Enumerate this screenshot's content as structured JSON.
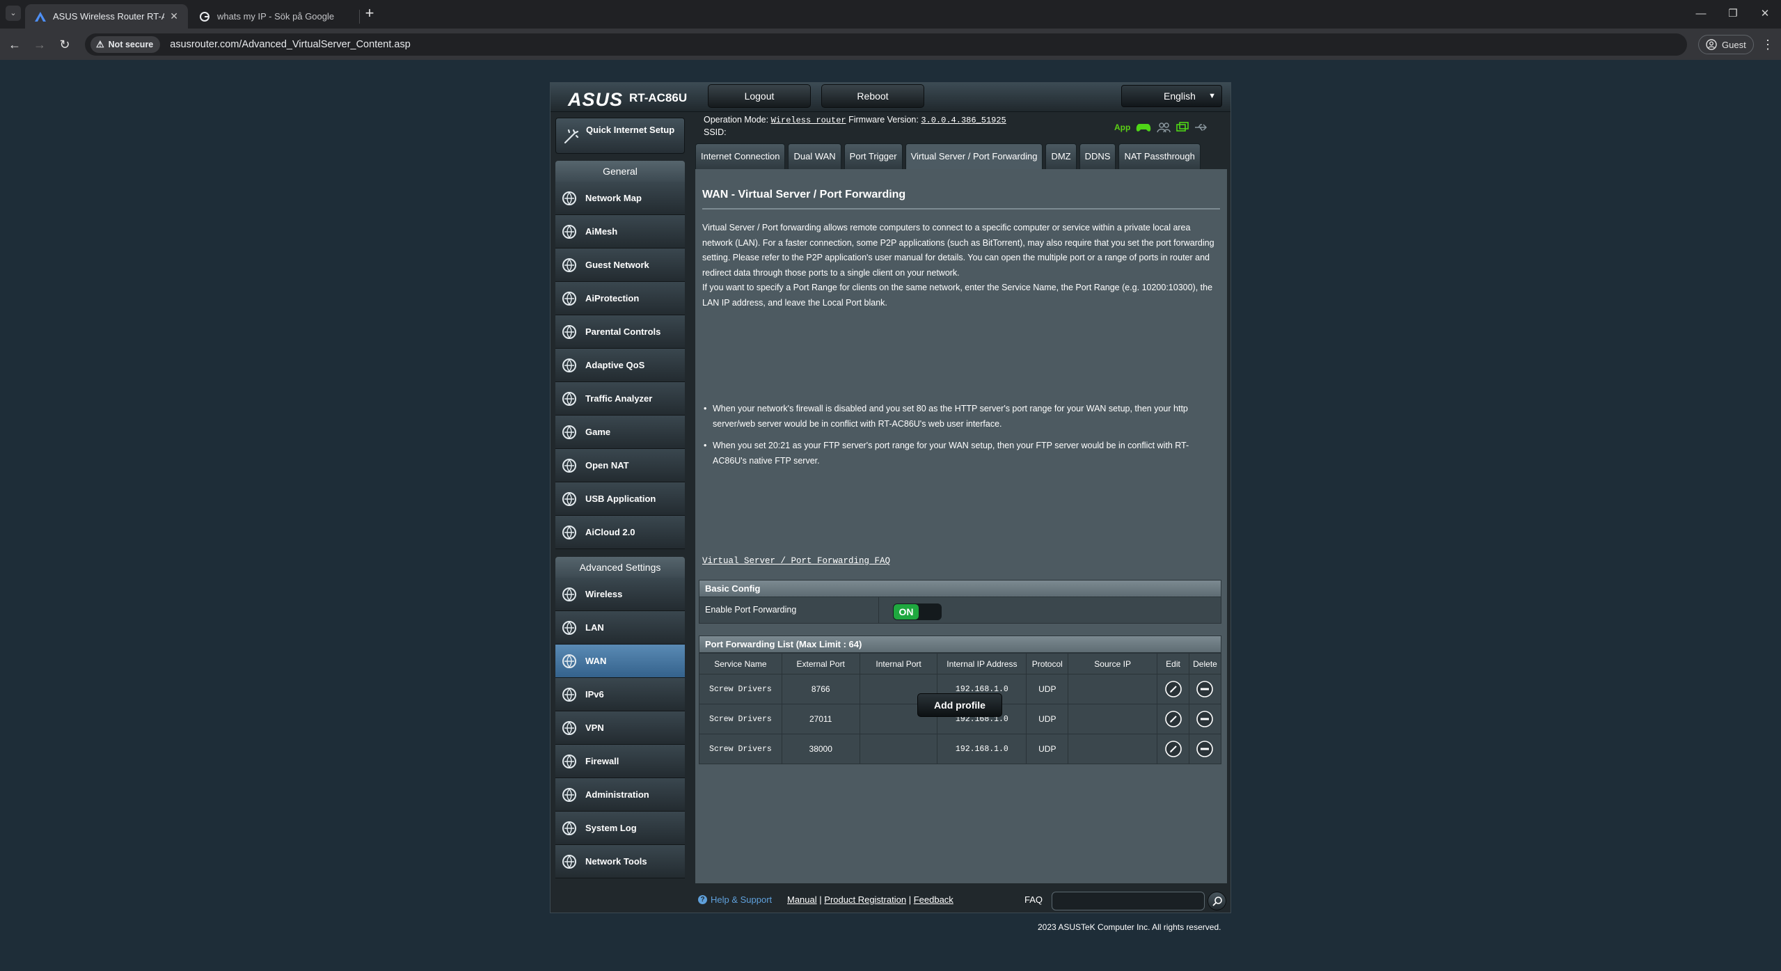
{
  "browser": {
    "tabs": [
      {
        "title": "ASUS Wireless Router RT-AC86",
        "active": true
      },
      {
        "title": "whats my IP - Sök på Google",
        "active": false
      }
    ],
    "security_chip": "Not secure",
    "url": "asusrouter.com/Advanced_VirtualServer_Content.asp",
    "profile": "Guest"
  },
  "router": {
    "brand": "ASUS",
    "model": "RT-AC86U",
    "logout": "Logout",
    "reboot": "Reboot",
    "language": "English",
    "operation_mode_label": "Operation Mode:",
    "operation_mode": "Wireless router",
    "firmware_label": "Firmware Version:",
    "firmware": "3.0.0.4.386_51925",
    "ssid_label": "SSID:",
    "app_label": "App"
  },
  "sidebar": {
    "quick_setup": "Quick Internet Setup",
    "general_header": "General",
    "general_items": [
      {
        "label": "Network Map",
        "icon": "network-map-icon"
      },
      {
        "label": "AiMesh",
        "icon": "aimesh-icon"
      },
      {
        "label": "Guest Network",
        "icon": "guest-network-icon"
      },
      {
        "label": "AiProtection",
        "icon": "aiprotection-icon"
      },
      {
        "label": "Parental Controls",
        "icon": "parental-controls-icon"
      },
      {
        "label": "Adaptive QoS",
        "icon": "adaptive-qos-icon"
      },
      {
        "label": "Traffic Analyzer",
        "icon": "traffic-analyzer-icon"
      },
      {
        "label": "Game",
        "icon": "game-icon"
      },
      {
        "label": "Open NAT",
        "icon": "open-nat-icon"
      },
      {
        "label": "USB Application",
        "icon": "usb-application-icon"
      },
      {
        "label": "AiCloud 2.0",
        "icon": "aicloud-icon"
      }
    ],
    "advanced_header": "Advanced Settings",
    "advanced_items": [
      {
        "label": "Wireless",
        "icon": "wireless-icon"
      },
      {
        "label": "LAN",
        "icon": "lan-icon"
      },
      {
        "label": "WAN",
        "icon": "wan-icon",
        "active": true
      },
      {
        "label": "IPv6",
        "icon": "ipv6-icon"
      },
      {
        "label": "VPN",
        "icon": "vpn-icon"
      },
      {
        "label": "Firewall",
        "icon": "firewall-icon"
      },
      {
        "label": "Administration",
        "icon": "administration-icon"
      },
      {
        "label": "System Log",
        "icon": "system-log-icon"
      },
      {
        "label": "Network Tools",
        "icon": "network-tools-icon"
      }
    ]
  },
  "tabs": [
    {
      "label": "Internet Connection"
    },
    {
      "label": "Dual WAN"
    },
    {
      "label": "Port Trigger"
    },
    {
      "label": "Virtual Server / Port Forwarding",
      "active": true
    },
    {
      "label": "DMZ"
    },
    {
      "label": "DDNS"
    },
    {
      "label": "NAT Passthrough"
    }
  ],
  "content": {
    "title": "WAN - Virtual Server / Port Forwarding",
    "desc1": "Virtual Server / Port forwarding allows remote computers to connect to a specific computer or service within a private local area network (LAN). For a faster connection, some P2P applications (such as BitTorrent), may also require that you set the port forwarding setting. Please refer to the P2P application's user manual for details. You can open the multiple port or a range of ports in router and redirect data through those ports to a single client on your network.",
    "desc2": "If you want to specify a Port Range for clients on the same network, enter the Service Name, the Port Range (e.g. 10200:10300), the LAN IP address, and leave the Local Port blank.",
    "bullet1": "When your network's firewall is disabled and you set 80 as the HTTP server's port range for your WAN setup, then your http server/web server would be in conflict with RT-AC86U's web user interface.",
    "bullet2": "When you set 20:21 as your FTP server's port range for your WAN setup, then your FTP server would be in conflict with RT-AC86U's native FTP server.",
    "faq_link": "Virtual Server / Port Forwarding FAQ",
    "basic_config": "Basic Config",
    "enable_label": "Enable Port Forwarding",
    "toggle_state": "ON",
    "list_header": "Port Forwarding List (Max Limit : 64)",
    "columns": [
      "Service Name",
      "External Port",
      "Internal Port",
      "Internal IP Address",
      "Protocol",
      "Source IP",
      "Edit",
      "Delete"
    ],
    "rows": [
      {
        "service": "Screw Drivers",
        "external": "8766",
        "internal": "",
        "ip": "192.168.1.0",
        "protocol": "UDP",
        "source": ""
      },
      {
        "service": "Screw Drivers",
        "external": "27011",
        "internal": "",
        "ip": "192.168.1.0",
        "protocol": "UDP",
        "source": ""
      },
      {
        "service": "Screw Drivers",
        "external": "38000",
        "internal": "",
        "ip": "192.168.1.0",
        "protocol": "UDP",
        "source": ""
      }
    ],
    "add_profile": "Add profile"
  },
  "footer": {
    "help": "Help & Support",
    "manual": "Manual",
    "registration": "Product Registration",
    "feedback": "Feedback",
    "sep": "|",
    "faq": "FAQ",
    "copyright": "2023 ASUSTeK Computer Inc. All rights reserved."
  }
}
